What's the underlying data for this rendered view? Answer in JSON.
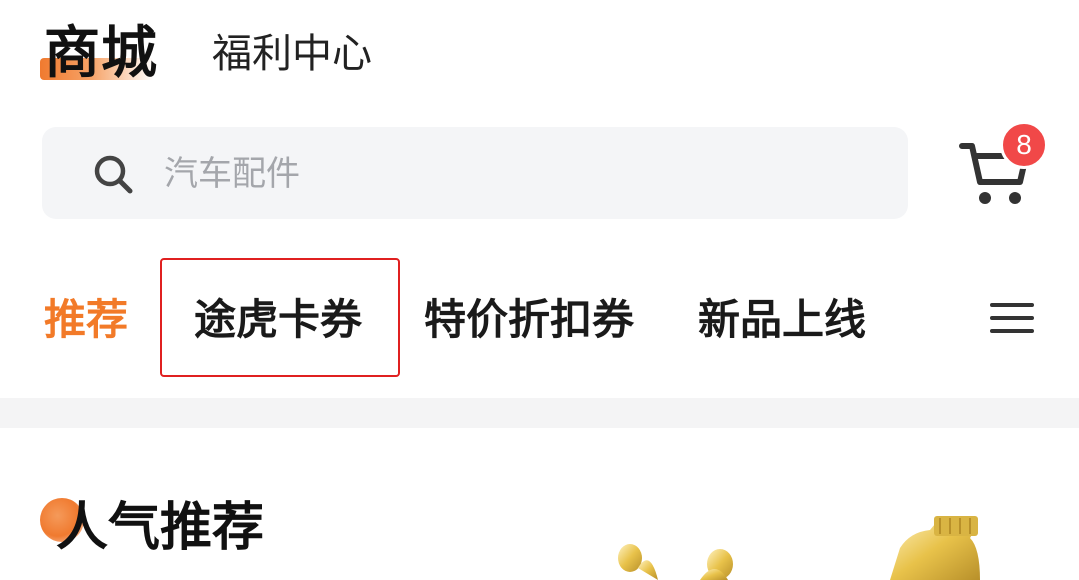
{
  "header": {
    "tabs": [
      {
        "label": "商城",
        "active": true
      },
      {
        "label": "福利中心",
        "active": false
      }
    ],
    "accent_color": "#f07a2f"
  },
  "search": {
    "placeholder": "汽车配件",
    "icon": "search-icon"
  },
  "cart": {
    "icon": "cart-icon",
    "badge_count": "8",
    "badge_color": "#f14848"
  },
  "category_tabs": [
    {
      "label": "推荐",
      "active": true
    },
    {
      "label": "途虎卡券",
      "active": false,
      "highlighted": true
    },
    {
      "label": "特价折扣券",
      "active": false
    },
    {
      "label": "新品上线",
      "active": false
    }
  ],
  "category_menu_icon": "menu-icon",
  "active_color": "#f27a28",
  "highlight_color": "#e02020",
  "section": {
    "title": "人气推荐"
  },
  "product_image": "engine-oil-bottle-splash"
}
